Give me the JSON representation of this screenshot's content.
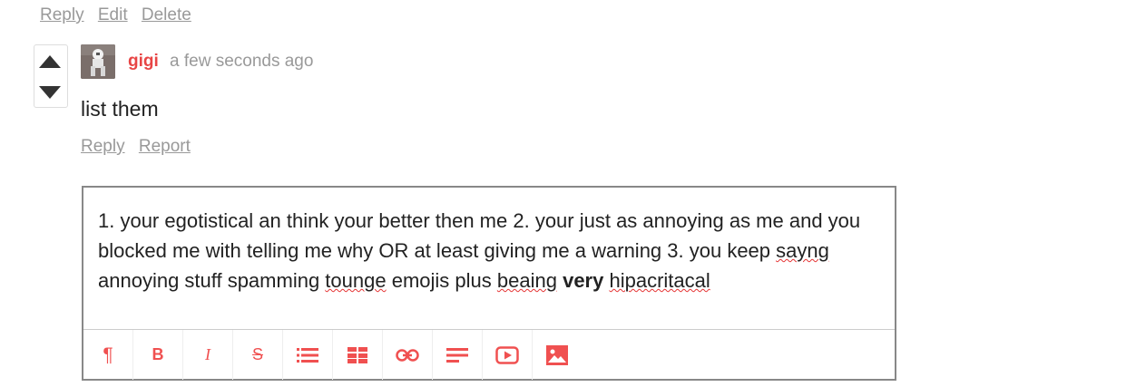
{
  "top_actions": {
    "reply": "Reply",
    "edit": "Edit",
    "delete": "Delete"
  },
  "comment": {
    "author": "gigi",
    "timestamp": "a few seconds ago",
    "text": "list them",
    "actions": {
      "reply": "Reply",
      "report": "Report"
    }
  },
  "reply_box": {
    "segments": [
      "1. your egotistical an think your better then me 2. your just as annoying as me and you blocked me with telling me why OR at least giving me a warning 3. you keep ",
      "sayng",
      " annoying stuff spamming ",
      "tounge",
      " emojis plus ",
      "beaing",
      " ",
      "very",
      " ",
      "hipacritacal"
    ]
  },
  "toolbar": {
    "paragraph": "¶",
    "bold": "B",
    "italic": "I",
    "strike": "S"
  },
  "colors": {
    "accent": "#e84545",
    "muted": "#999999",
    "border": "#888888"
  },
  "icons": [
    "upvote-icon",
    "downvote-icon",
    "paragraph-icon",
    "bold-icon",
    "italic-icon",
    "strikethrough-icon",
    "list-icon",
    "table-icon",
    "link-icon",
    "align-icon",
    "video-icon",
    "image-icon"
  ]
}
